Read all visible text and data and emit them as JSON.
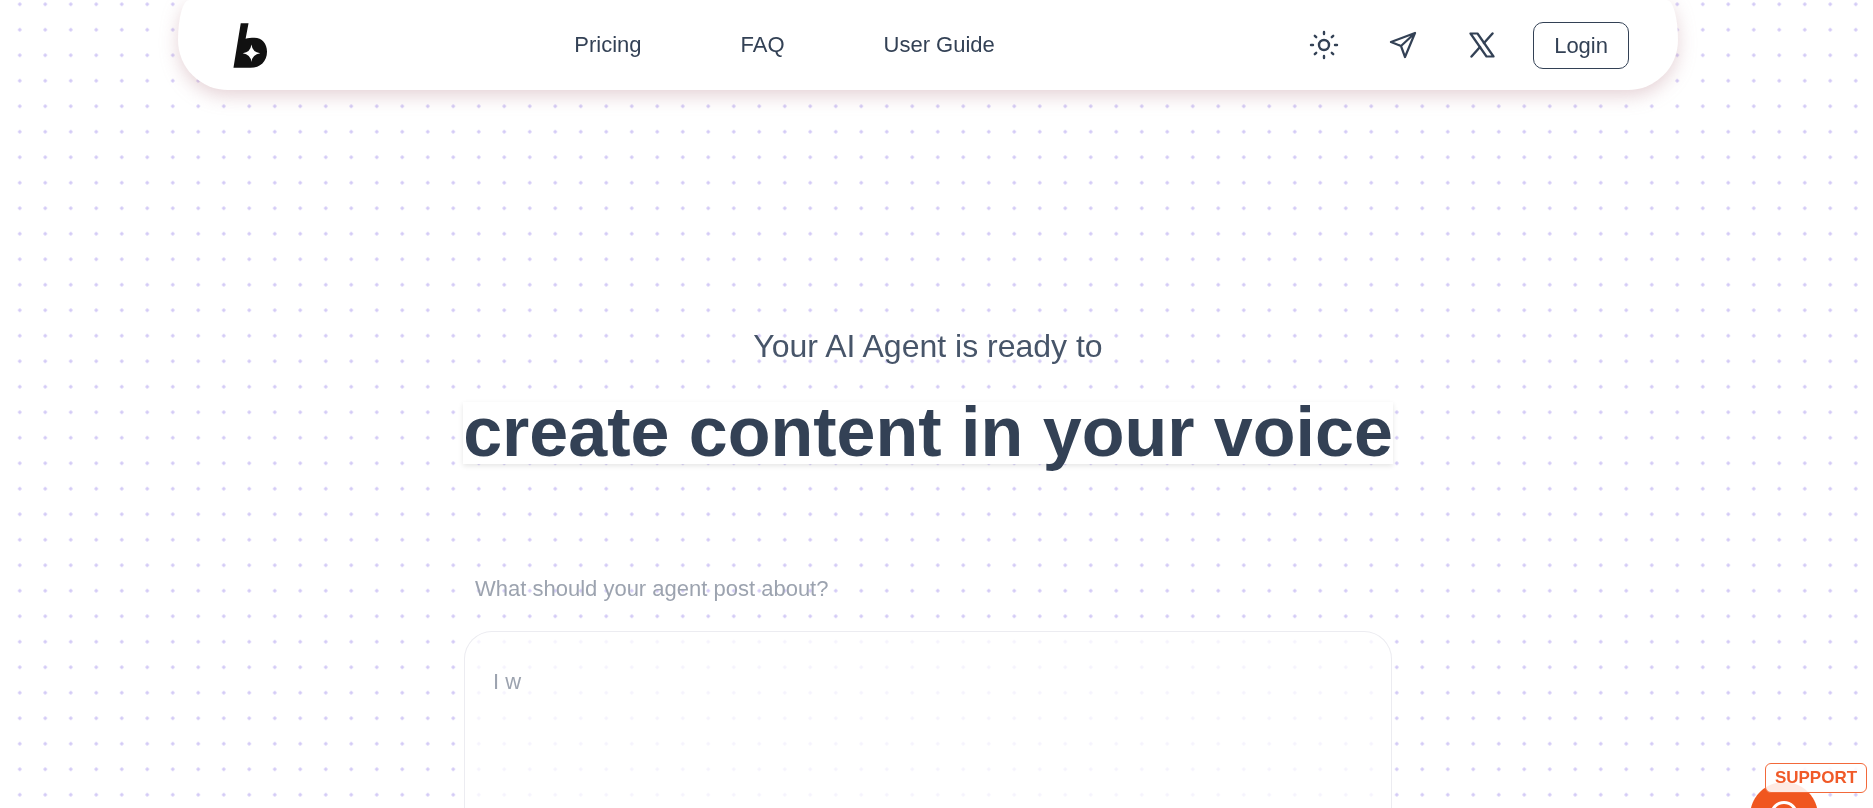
{
  "navbar": {
    "links": [
      "Pricing",
      "FAQ",
      "User Guide"
    ],
    "login_button": "Login"
  },
  "hero": {
    "subtitle": "Your AI Agent is ready to",
    "headline": "create content in your voice"
  },
  "prompt": {
    "label": "What should your agent post about?",
    "placeholder": "I w"
  },
  "support": {
    "label": "SUPPORT"
  }
}
